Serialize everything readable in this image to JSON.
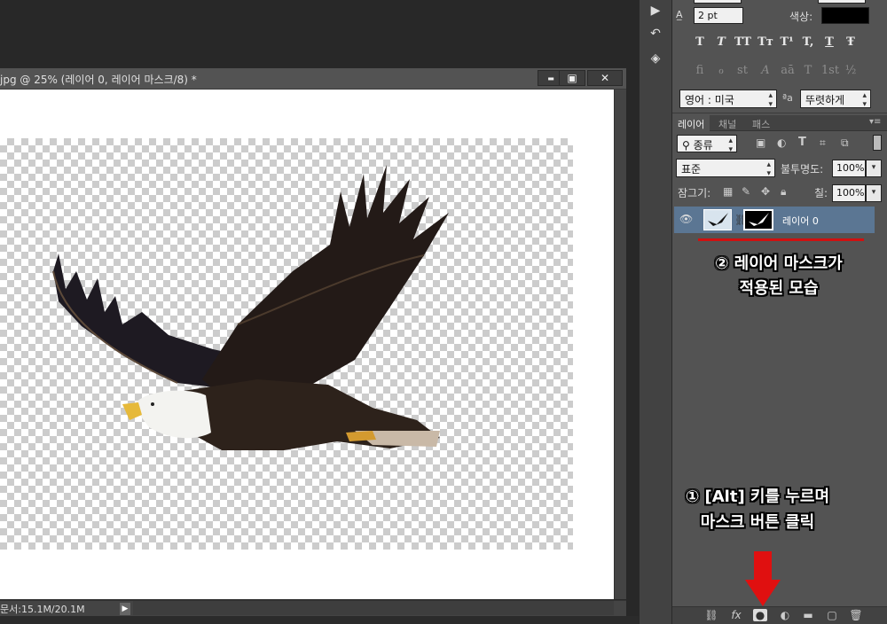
{
  "document": {
    "title": "jpg @ 25% (레이어 0, 레이어 마스크/8) *",
    "status": "문서:15.1M/20.1M"
  },
  "window_buttons": {
    "minimize": "▬",
    "maximize": "▣",
    "close": "✕"
  },
  "character_panel": {
    "leading_value": "2 pt",
    "color_label": "색상:",
    "color_value": "#000000",
    "style_buttons": [
      "T",
      "T",
      "TT",
      "Tт",
      "T¹",
      "T,",
      "T",
      "Ŧ"
    ],
    "opentype_buttons": [
      "fi",
      "ℴ",
      "st",
      "A",
      "aā",
      "T",
      "1st",
      "½"
    ],
    "language": "영어 : 미국",
    "aa_label": "ªa",
    "antialias": "뚜렷하게"
  },
  "layers_panel": {
    "tabs": [
      "레이어",
      "채널",
      "패스"
    ],
    "filter_kind": "종류",
    "blend_mode": "표준",
    "opacity_label": "불투명도:",
    "opacity_value": "100%",
    "lock_label": "잠그기:",
    "fill_label": "칠:",
    "fill_value": "100%",
    "layer_name": "레이어 0"
  },
  "annotations": {
    "step2_line1": "② 레이어 마스크가",
    "step2_line2": "적용된 모습",
    "step1_line1": "① [Alt] 키를 누르며",
    "step1_line2": "마스크 버튼 클릭"
  },
  "icons": [
    "play-icon",
    "history-icon",
    "cube-icon",
    "eye-icon",
    "chain-icon",
    "link-icon",
    "fx-icon",
    "mask-icon",
    "adjustment-icon",
    "folder-icon",
    "new-layer-icon",
    "trash-icon"
  ],
  "colors": {
    "accent_red": "#e01010",
    "layer_selected": "#5b7693"
  }
}
